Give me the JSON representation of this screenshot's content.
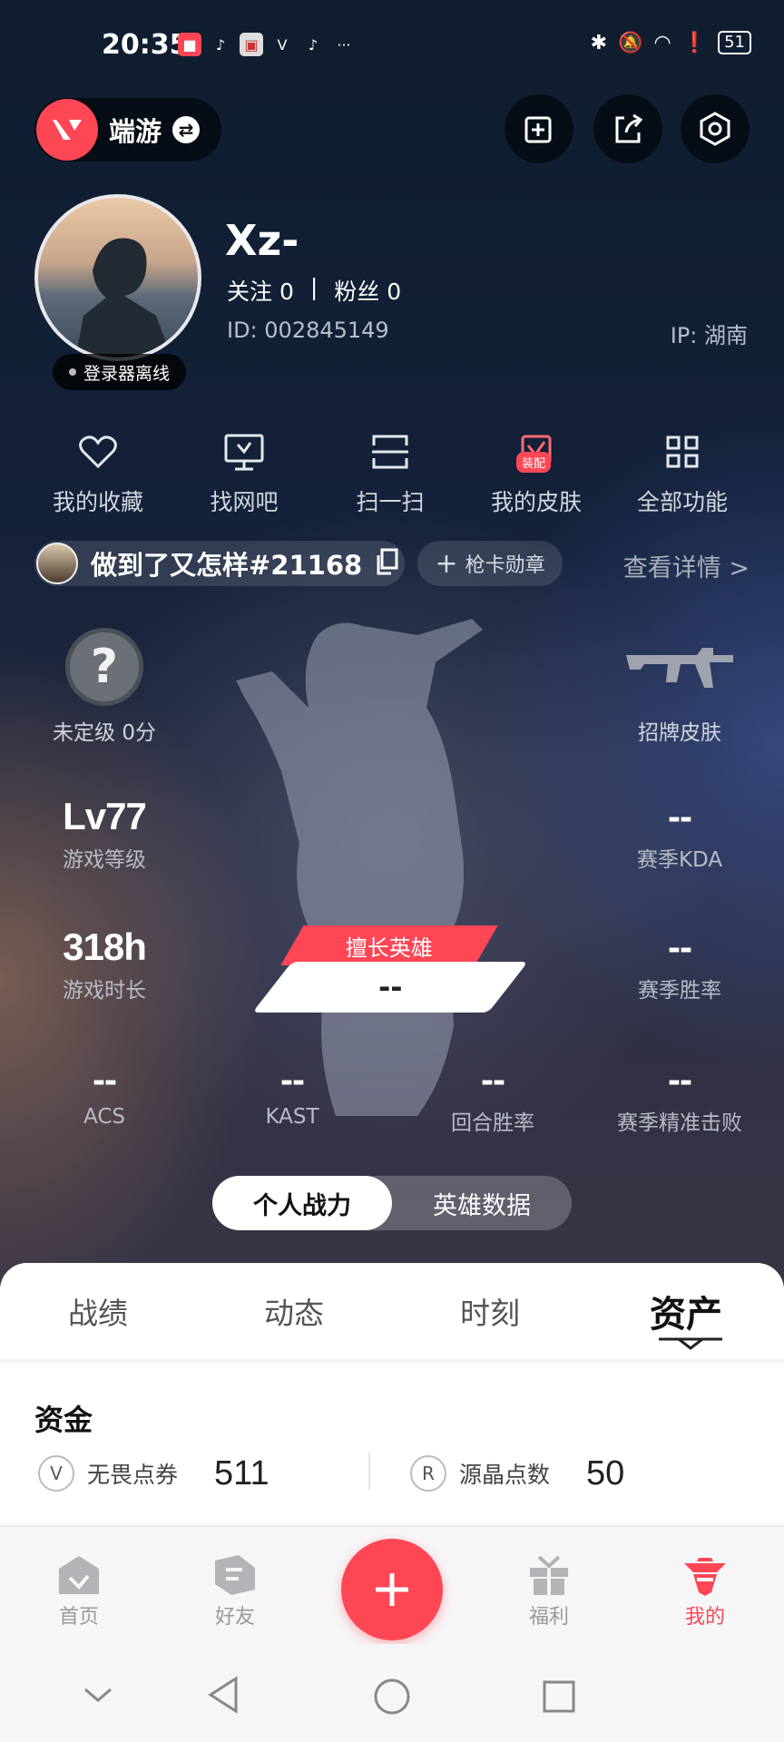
{
  "status": {
    "time": "20:35",
    "battery": "51"
  },
  "header": {
    "app_name": "端游"
  },
  "profile": {
    "name": "Xz-",
    "follow_label": "关注 0",
    "separator": "|",
    "fans_label": "粉丝 0",
    "id_text": "ID:  002845149",
    "ip_text": "IP:  湖南",
    "online_status": "登录器离线"
  },
  "functions": [
    {
      "label": "我的收藏",
      "icon": "heart-icon"
    },
    {
      "label": "找网吧",
      "icon": "monitor-icon"
    },
    {
      "label": "扫一扫",
      "icon": "scan-icon"
    },
    {
      "label": "我的皮肤",
      "icon": "skin-icon",
      "badge": "装配"
    },
    {
      "label": "全部功能",
      "icon": "grid-icon"
    }
  ],
  "rank": {
    "player_name": "做到了又怎样#21168",
    "medal_label": "枪卡勋章",
    "detail_link": "查看详情 >"
  },
  "stats": {
    "rank_label": "未定级 0分",
    "signature_skin_label": "招牌皮肤",
    "level_value": "Lv77",
    "level_label": "游戏等级",
    "kda_value": "--",
    "kda_label": "赛季KDA",
    "hours_value": "318h",
    "hours_label": "游戏时长",
    "winrate_value": "--",
    "winrate_label": "赛季胜率",
    "best_hero_tag": "擅长英雄",
    "best_hero_value": "--",
    "acs_value": "--",
    "acs_label": "ACS",
    "kast_value": "--",
    "kast_label": "KAST",
    "round_win_value": "--",
    "round_win_label": "回合胜率",
    "precision_value": "--",
    "precision_label": "赛季精准击败"
  },
  "toggle": {
    "personal": "个人战力",
    "hero": "英雄数据"
  },
  "tabs": [
    "战绩",
    "动态",
    "时刻",
    "资产"
  ],
  "assets": {
    "title": "资金",
    "items": [
      {
        "label": "无畏点券",
        "value": "511",
        "icon": "V"
      },
      {
        "label": "源晶点数",
        "value": "50",
        "icon": "R"
      }
    ]
  },
  "nav": [
    "首页",
    "好友",
    "福利",
    "我的"
  ],
  "colors": {
    "accent": "#ff4655"
  }
}
